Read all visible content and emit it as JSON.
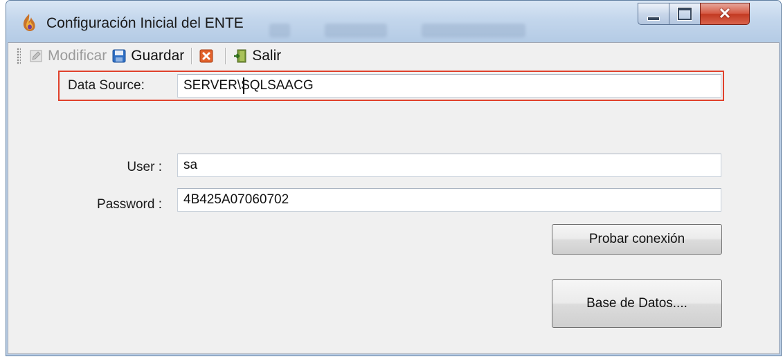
{
  "window": {
    "title": "Configuración Inicial del ENTE",
    "controls": {
      "minimize": "minimize",
      "maximize": "maximize",
      "close": "close"
    }
  },
  "toolbar": {
    "modificar_label": "Modificar",
    "guardar_label": "Guardar",
    "salir_label": "Salir",
    "icons": {
      "modificar": "edit-icon",
      "guardar": "save-disk-icon",
      "cancel": "cancel-x-icon",
      "salir": "exit-door-icon"
    }
  },
  "form": {
    "data_source": {
      "label": "Data Source:",
      "value": "SERVER\\SQLSAACG"
    },
    "user": {
      "label": "User :",
      "value": "sa"
    },
    "password": {
      "label": "Password :",
      "value": "4B425A07060702"
    }
  },
  "buttons": {
    "probar_label": "Probar conexión",
    "base_datos_label": "Base de Datos...."
  },
  "colors": {
    "highlight_box": "#e0412b",
    "close_button": "#c9432c",
    "titlebar": "#c3d6ec"
  }
}
